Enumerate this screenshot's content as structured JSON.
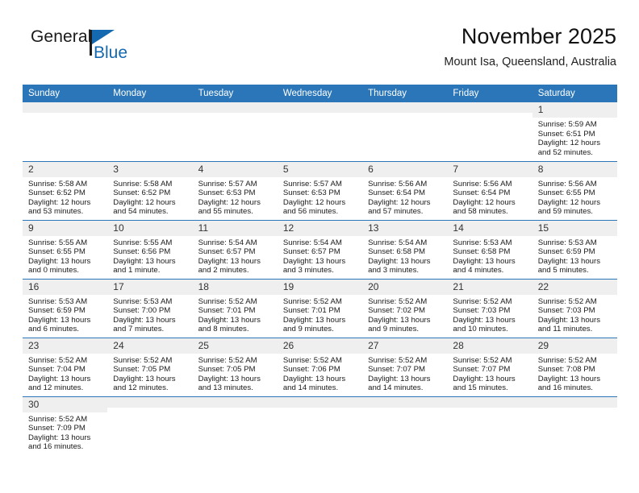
{
  "brand": {
    "name_top": "General",
    "name_bottom": "Blue",
    "accent_color": "#1569b0",
    "flag_icon": "triangle-flag-icon"
  },
  "header": {
    "title": "November 2025",
    "subtitle": "Mount Isa, Queensland, Australia"
  },
  "theme": {
    "header_blue": "#2b76b9",
    "daynum_band": "#efefef",
    "row_border": "#2b76b9"
  },
  "weekdays": [
    "Sunday",
    "Monday",
    "Tuesday",
    "Wednesday",
    "Thursday",
    "Friday",
    "Saturday"
  ],
  "labels": {
    "sunrise": "Sunrise:",
    "sunset": "Sunset:",
    "daylight": "Daylight:"
  },
  "weeks": [
    [
      {
        "day": "",
        "blank": true
      },
      {
        "day": "",
        "blank": true
      },
      {
        "day": "",
        "blank": true
      },
      {
        "day": "",
        "blank": true
      },
      {
        "day": "",
        "blank": true
      },
      {
        "day": "",
        "blank": true
      },
      {
        "day": "1",
        "sunrise": "Sunrise: 5:59 AM",
        "sunset": "Sunset: 6:51 PM",
        "daylight_l1": "Daylight: 12 hours",
        "daylight_l2": "and 52 minutes."
      }
    ],
    [
      {
        "day": "2",
        "sunrise": "Sunrise: 5:58 AM",
        "sunset": "Sunset: 6:52 PM",
        "daylight_l1": "Daylight: 12 hours",
        "daylight_l2": "and 53 minutes."
      },
      {
        "day": "3",
        "sunrise": "Sunrise: 5:58 AM",
        "sunset": "Sunset: 6:52 PM",
        "daylight_l1": "Daylight: 12 hours",
        "daylight_l2": "and 54 minutes."
      },
      {
        "day": "4",
        "sunrise": "Sunrise: 5:57 AM",
        "sunset": "Sunset: 6:53 PM",
        "daylight_l1": "Daylight: 12 hours",
        "daylight_l2": "and 55 minutes."
      },
      {
        "day": "5",
        "sunrise": "Sunrise: 5:57 AM",
        "sunset": "Sunset: 6:53 PM",
        "daylight_l1": "Daylight: 12 hours",
        "daylight_l2": "and 56 minutes."
      },
      {
        "day": "6",
        "sunrise": "Sunrise: 5:56 AM",
        "sunset": "Sunset: 6:54 PM",
        "daylight_l1": "Daylight: 12 hours",
        "daylight_l2": "and 57 minutes."
      },
      {
        "day": "7",
        "sunrise": "Sunrise: 5:56 AM",
        "sunset": "Sunset: 6:54 PM",
        "daylight_l1": "Daylight: 12 hours",
        "daylight_l2": "and 58 minutes."
      },
      {
        "day": "8",
        "sunrise": "Sunrise: 5:56 AM",
        "sunset": "Sunset: 6:55 PM",
        "daylight_l1": "Daylight: 12 hours",
        "daylight_l2": "and 59 minutes."
      }
    ],
    [
      {
        "day": "9",
        "sunrise": "Sunrise: 5:55 AM",
        "sunset": "Sunset: 6:55 PM",
        "daylight_l1": "Daylight: 13 hours",
        "daylight_l2": "and 0 minutes."
      },
      {
        "day": "10",
        "sunrise": "Sunrise: 5:55 AM",
        "sunset": "Sunset: 6:56 PM",
        "daylight_l1": "Daylight: 13 hours",
        "daylight_l2": "and 1 minute."
      },
      {
        "day": "11",
        "sunrise": "Sunrise: 5:54 AM",
        "sunset": "Sunset: 6:57 PM",
        "daylight_l1": "Daylight: 13 hours",
        "daylight_l2": "and 2 minutes."
      },
      {
        "day": "12",
        "sunrise": "Sunrise: 5:54 AM",
        "sunset": "Sunset: 6:57 PM",
        "daylight_l1": "Daylight: 13 hours",
        "daylight_l2": "and 3 minutes."
      },
      {
        "day": "13",
        "sunrise": "Sunrise: 5:54 AM",
        "sunset": "Sunset: 6:58 PM",
        "daylight_l1": "Daylight: 13 hours",
        "daylight_l2": "and 3 minutes."
      },
      {
        "day": "14",
        "sunrise": "Sunrise: 5:53 AM",
        "sunset": "Sunset: 6:58 PM",
        "daylight_l1": "Daylight: 13 hours",
        "daylight_l2": "and 4 minutes."
      },
      {
        "day": "15",
        "sunrise": "Sunrise: 5:53 AM",
        "sunset": "Sunset: 6:59 PM",
        "daylight_l1": "Daylight: 13 hours",
        "daylight_l2": "and 5 minutes."
      }
    ],
    [
      {
        "day": "16",
        "sunrise": "Sunrise: 5:53 AM",
        "sunset": "Sunset: 6:59 PM",
        "daylight_l1": "Daylight: 13 hours",
        "daylight_l2": "and 6 minutes."
      },
      {
        "day": "17",
        "sunrise": "Sunrise: 5:53 AM",
        "sunset": "Sunset: 7:00 PM",
        "daylight_l1": "Daylight: 13 hours",
        "daylight_l2": "and 7 minutes."
      },
      {
        "day": "18",
        "sunrise": "Sunrise: 5:52 AM",
        "sunset": "Sunset: 7:01 PM",
        "daylight_l1": "Daylight: 13 hours",
        "daylight_l2": "and 8 minutes."
      },
      {
        "day": "19",
        "sunrise": "Sunrise: 5:52 AM",
        "sunset": "Sunset: 7:01 PM",
        "daylight_l1": "Daylight: 13 hours",
        "daylight_l2": "and 9 minutes."
      },
      {
        "day": "20",
        "sunrise": "Sunrise: 5:52 AM",
        "sunset": "Sunset: 7:02 PM",
        "daylight_l1": "Daylight: 13 hours",
        "daylight_l2": "and 9 minutes."
      },
      {
        "day": "21",
        "sunrise": "Sunrise: 5:52 AM",
        "sunset": "Sunset: 7:03 PM",
        "daylight_l1": "Daylight: 13 hours",
        "daylight_l2": "and 10 minutes."
      },
      {
        "day": "22",
        "sunrise": "Sunrise: 5:52 AM",
        "sunset": "Sunset: 7:03 PM",
        "daylight_l1": "Daylight: 13 hours",
        "daylight_l2": "and 11 minutes."
      }
    ],
    [
      {
        "day": "23",
        "sunrise": "Sunrise: 5:52 AM",
        "sunset": "Sunset: 7:04 PM",
        "daylight_l1": "Daylight: 13 hours",
        "daylight_l2": "and 12 minutes."
      },
      {
        "day": "24",
        "sunrise": "Sunrise: 5:52 AM",
        "sunset": "Sunset: 7:05 PM",
        "daylight_l1": "Daylight: 13 hours",
        "daylight_l2": "and 12 minutes."
      },
      {
        "day": "25",
        "sunrise": "Sunrise: 5:52 AM",
        "sunset": "Sunset: 7:05 PM",
        "daylight_l1": "Daylight: 13 hours",
        "daylight_l2": "and 13 minutes."
      },
      {
        "day": "26",
        "sunrise": "Sunrise: 5:52 AM",
        "sunset": "Sunset: 7:06 PM",
        "daylight_l1": "Daylight: 13 hours",
        "daylight_l2": "and 14 minutes."
      },
      {
        "day": "27",
        "sunrise": "Sunrise: 5:52 AM",
        "sunset": "Sunset: 7:07 PM",
        "daylight_l1": "Daylight: 13 hours",
        "daylight_l2": "and 14 minutes."
      },
      {
        "day": "28",
        "sunrise": "Sunrise: 5:52 AM",
        "sunset": "Sunset: 7:07 PM",
        "daylight_l1": "Daylight: 13 hours",
        "daylight_l2": "and 15 minutes."
      },
      {
        "day": "29",
        "sunrise": "Sunrise: 5:52 AM",
        "sunset": "Sunset: 7:08 PM",
        "daylight_l1": "Daylight: 13 hours",
        "daylight_l2": "and 16 minutes."
      }
    ],
    [
      {
        "day": "30",
        "sunrise": "Sunrise: 5:52 AM",
        "sunset": "Sunset: 7:09 PM",
        "daylight_l1": "Daylight: 13 hours",
        "daylight_l2": "and 16 minutes."
      },
      {
        "day": "",
        "blank": true
      },
      {
        "day": "",
        "blank": true
      },
      {
        "day": "",
        "blank": true
      },
      {
        "day": "",
        "blank": true
      },
      {
        "day": "",
        "blank": true
      },
      {
        "day": "",
        "blank": true
      }
    ]
  ]
}
